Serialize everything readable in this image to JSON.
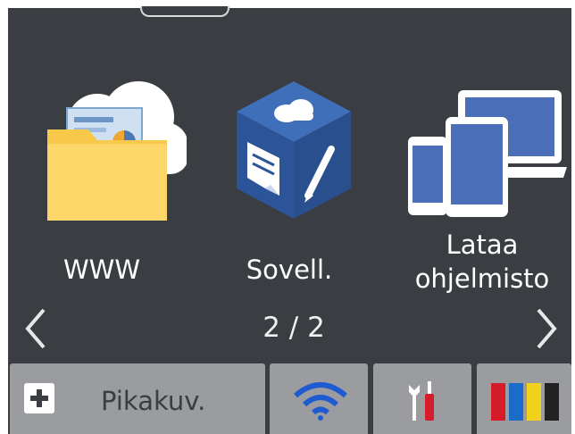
{
  "apps": [
    {
      "label": "WWW",
      "icon": "web-folder-cloud-icon"
    },
    {
      "label": "Sovell.",
      "icon": "apps-cube-icon"
    },
    {
      "label": "Lataa\nohjelmisto",
      "icon": "download-devices-icon"
    }
  ],
  "navigation": {
    "page_indicator": "2 / 2",
    "prev_icon": "chevron-left-icon",
    "next_icon": "chevron-right-icon"
  },
  "bottom_bar": {
    "shortcut_label": "Pikakuv.",
    "shortcut_icon": "plus-icon",
    "wifi_icon": "wifi-icon",
    "settings_icon": "settings-tools-icon",
    "ink_icon": "ink-cartridges-icon"
  },
  "colors": {
    "background": "#3a3d42",
    "bar": "#9a9ca0",
    "wifi": "#1f5bd0",
    "ink_red": "#d61b2a",
    "ink_blue": "#1b6cc8",
    "ink_yellow": "#f2d11a",
    "ink_black": "#222222"
  }
}
